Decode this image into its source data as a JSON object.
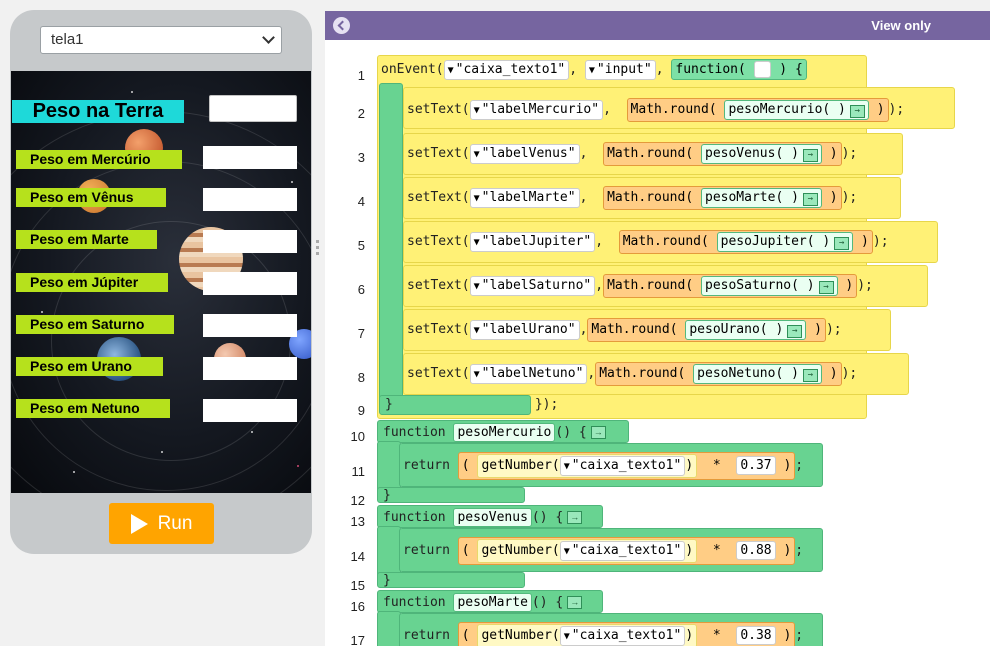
{
  "screen_select": {
    "value": "tela1"
  },
  "app": {
    "title": "Peso na Terra",
    "rows": [
      {
        "label": "Peso em Mercúrio"
      },
      {
        "label": "Peso em Vênus"
      },
      {
        "label": "Peso em Marte"
      },
      {
        "label": "Peso em Júpiter"
      },
      {
        "label": "Peso em Saturno"
      },
      {
        "label": "Peso em Urano"
      },
      {
        "label": "Peso em Netuno"
      }
    ],
    "run_label": "Run"
  },
  "editor": {
    "view_label": "View only",
    "line_numbers": [
      "1",
      "2",
      "3",
      "4",
      "5",
      "6",
      "7",
      "8",
      "9",
      "10",
      "11",
      "12",
      "13",
      "14",
      "15",
      "16",
      "17"
    ],
    "line1": {
      "kw": "onEvent",
      "arg1": "\"caixa_texto1\"",
      "arg2": "\"input\"",
      "fn": "function"
    },
    "set_lines": [
      {
        "target": "\"labelMercurio\"",
        "fn": "pesoMercurio"
      },
      {
        "target": "\"labelVenus\"",
        "fn": "pesoVenus"
      },
      {
        "target": "\"labelMarte\"",
        "fn": "pesoMarte"
      },
      {
        "target": "\"labelJupiter\"",
        "fn": "pesoJupiter"
      },
      {
        "target": "\"labelSaturno\"",
        "fn": "pesoSaturno"
      },
      {
        "target": "\"labelUrano\"",
        "fn": "pesoUrano"
      },
      {
        "target": "\"labelNetuno\"",
        "fn": "pesoNetuno"
      }
    ],
    "set_kw": "setText",
    "math_obj": "Math",
    "round": ".round",
    "end_line9": "});",
    "functions": [
      {
        "name": "pesoMercurio",
        "factor": "0.37"
      },
      {
        "name": "pesoVenus",
        "factor": "0.88"
      },
      {
        "name": "pesoMarte",
        "factor": "0.38"
      }
    ],
    "func_kw": "function",
    "return_kw": "return",
    "getnum": "getNumber",
    "getnum_arg": "\"caixa_texto1\"",
    "mul": "*"
  }
}
